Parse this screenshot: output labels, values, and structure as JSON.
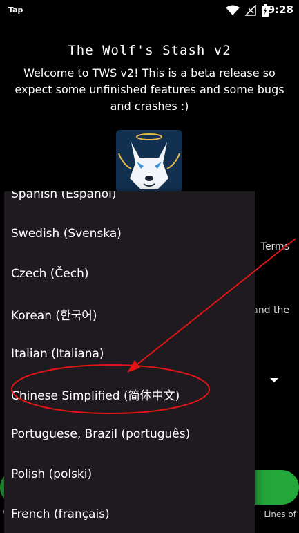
{
  "status_bar": {
    "left_label": "Tap",
    "time": "9:28",
    "icons": [
      "wifi-icon",
      "signal-icon",
      "battery-icon"
    ]
  },
  "app": {
    "title": "The Wolf's Stash v2",
    "welcome": "Welcome to TWS v2! This is a beta release so expect some unfinished features and some bugs and crashes :)",
    "logo": "wolf-logo"
  },
  "background": {
    "terms_fragment": "Terms",
    "and_the_fragment": "and the",
    "bottom_left": "V",
    "bottom_right": "| Lines of"
  },
  "language_menu": {
    "items": [
      "Spanish (Español)",
      "Swedish (Svenska)",
      "Czech (Čech)",
      "Korean (한국어)",
      "Italian (Italiana)",
      "Chinese Simplified (简体中文)",
      "Portuguese, Brazil (português)",
      "Polish (polski)",
      "French (français)"
    ],
    "highlighted_index": 5
  },
  "annotation": {
    "color": "#e01515"
  },
  "colors": {
    "accent_green": "#23a63a",
    "menu_bg": "#1e1a20"
  }
}
